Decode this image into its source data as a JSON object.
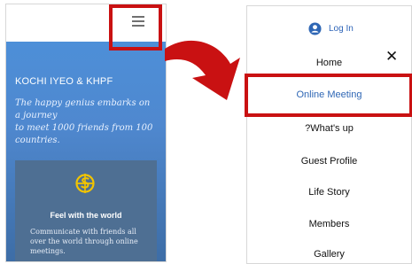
{
  "left_screen": {
    "hero": {
      "title": "KOCHI IYEO & KHPF",
      "line1": "The happy genius embarks on",
      "line2": "a journey",
      "line3": "to meet 1000 friends from 100",
      "line4": "countries."
    },
    "feature_card": {
      "icon": "globe-money-icon",
      "title": "Feel with the world",
      "line1": "Communicate with friends all",
      "line2": "over the world through online",
      "line3": "meetings."
    }
  },
  "menu_panel": {
    "login_label": "Log In",
    "items": [
      {
        "label": "Home"
      },
      {
        "label": "Online Meeting",
        "active": true
      },
      {
        "label": "?What's up"
      },
      {
        "label": "Guest Profile"
      },
      {
        "label": "Life Story"
      },
      {
        "label": "Members"
      },
      {
        "label": "Gallery"
      }
    ]
  },
  "colors": {
    "highlight": "#c91112",
    "accent": "#2f67b5",
    "hero_blue": "#4f88cf",
    "card": "#4e6f93",
    "icon": "#f2c400"
  }
}
